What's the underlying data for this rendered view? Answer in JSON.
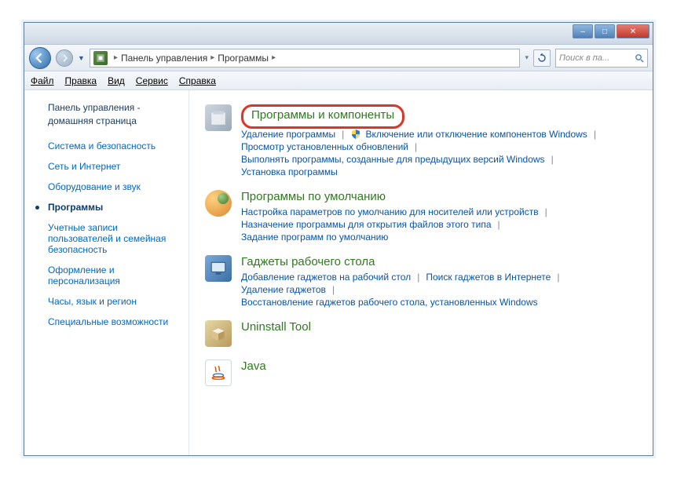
{
  "titlebar": {
    "close": "✕",
    "max": "□",
    "min": "–"
  },
  "breadcrumb": {
    "root": "Панель управления",
    "current": "Программы"
  },
  "search": {
    "placeholder": "Поиск в па..."
  },
  "menubar": [
    "Файл",
    "Правка",
    "Вид",
    "Сервис",
    "Справка"
  ],
  "sidebar": {
    "home": "Панель управления - домашняя страница",
    "items": [
      "Система и безопасность",
      "Сеть и Интернет",
      "Оборудование и звук",
      "Программы",
      "Учетные записи пользователей и семейная безопасность",
      "Оформление и персонализация",
      "Часы, язык и регион",
      "Специальные возможности"
    ]
  },
  "content": {
    "cat0": {
      "title": "Программы и компоненты",
      "links": [
        "Удаление программы",
        "Включение или отключение компонентов Windows",
        "Просмотр установленных обновлений",
        "Выполнять программы, созданные для предыдущих версий Windows",
        "Установка программы"
      ]
    },
    "cat1": {
      "title": "Программы по умолчанию",
      "links": [
        "Настройка параметров по умолчанию для носителей или устройств",
        "Назначение программы для открытия файлов этого типа",
        "Задание программ по умолчанию"
      ]
    },
    "cat2": {
      "title": "Гаджеты рабочего стола",
      "links": [
        "Добавление гаджетов на рабочий стол",
        "Поиск гаджетов в Интернете",
        "Удаление гаджетов",
        "Восстановление гаджетов рабочего стола, установленных Windows"
      ]
    },
    "cat3": {
      "title": "Uninstall Tool"
    },
    "cat4": {
      "title": "Java"
    }
  }
}
